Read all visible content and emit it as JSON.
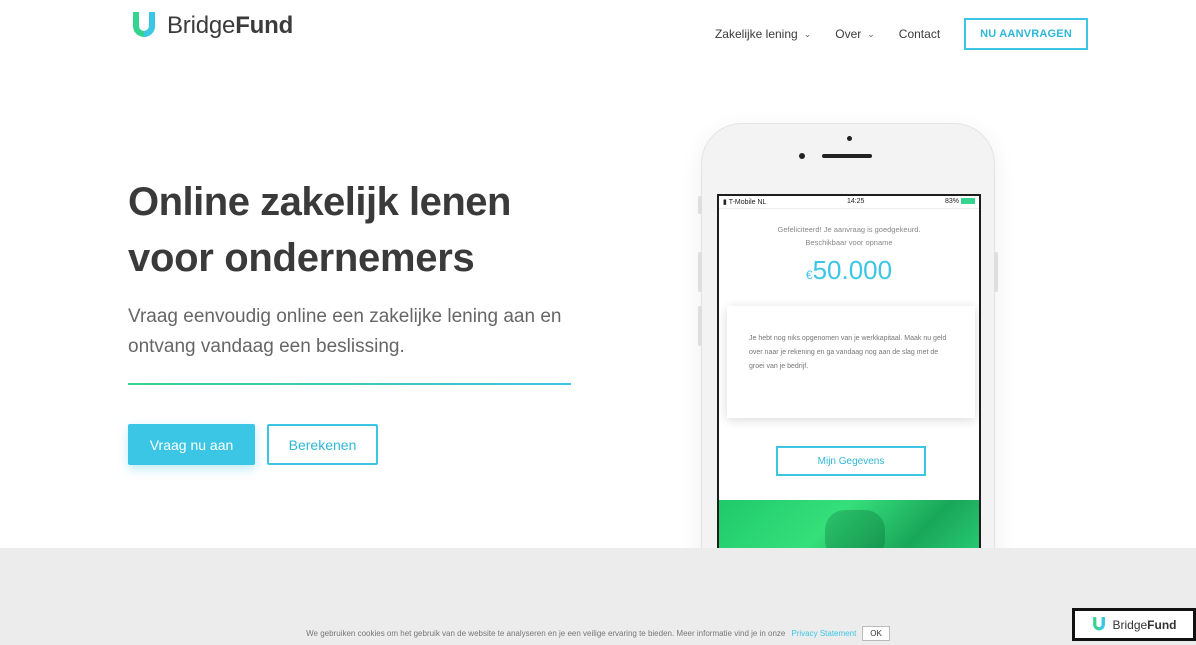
{
  "header": {
    "logo_prefix": "Bridge",
    "logo_suffix": "Fund",
    "nav": [
      {
        "label": "Zakelijke lening",
        "has_dropdown": true
      },
      {
        "label": "Over",
        "has_dropdown": true
      },
      {
        "label": "Contact",
        "has_dropdown": false
      }
    ],
    "cta_label": "NU AANVRAGEN"
  },
  "hero": {
    "title": "Online zakelijk lenen",
    "subtitle": "voor ondernemers",
    "description": "Vraag eenvoudig online een zakelijke lening aan en ontvang vandaag een beslissing.",
    "primary_button": "Vraag nu aan",
    "secondary_button": "Berekenen"
  },
  "phone": {
    "status": {
      "carrier": "T-Mobile NL",
      "time": "14:25",
      "battery": "83%"
    },
    "congrats": "Gefeliciteerd! Je aanvraag is goedgekeurd.",
    "available_label": "Beschikbaar voor opname",
    "currency": "€",
    "amount": "50.000",
    "card_text": "Je hebt nog niks opgenomen van je werkkapitaal. Maak nu geld over naar je rekening en ga vandaag nog aan de slag met de groei van je bedrijf.",
    "button": "Mijn Gegevens"
  },
  "cookie": {
    "text": "We gebruiken cookies om het gebruik van de website te analyseren en je een veilige ervaring te bieden. Meer informatie vind je in onze",
    "link": "Privacy Statement",
    "ok": "OK"
  },
  "badge": {
    "prefix": "Bridge",
    "suffix": "Fund"
  },
  "colors": {
    "accent": "#3cc6e6",
    "green": "#35d38f",
    "text": "#3a3a3a"
  }
}
